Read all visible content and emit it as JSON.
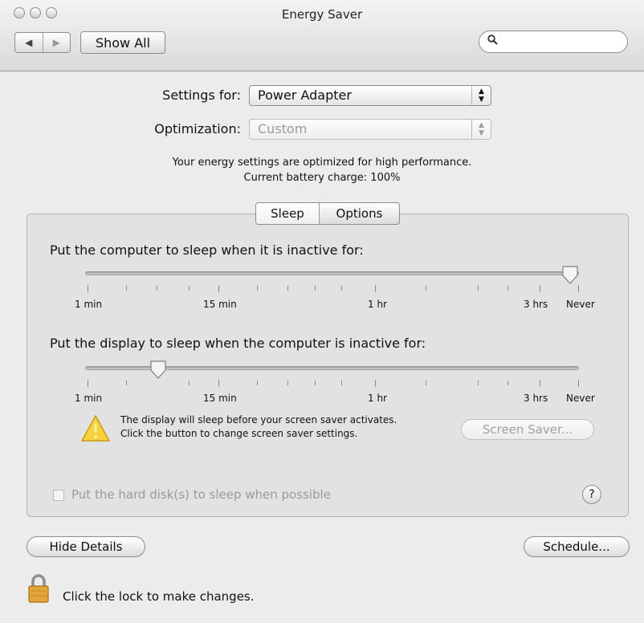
{
  "window": {
    "title": "Energy Saver"
  },
  "toolbar": {
    "back_glyph": "◀",
    "forward_glyph": "▶",
    "show_all_label": "Show All",
    "search_value": "",
    "search_icon": "magnifier-icon"
  },
  "settings": {
    "settings_for_label": "Settings for:",
    "settings_for_value": "Power Adapter",
    "optimization_label": "Optimization:",
    "optimization_value": "Custom",
    "info_line_1": "Your energy settings are optimized for high performance.",
    "info_line_2": "Current battery charge: 100%"
  },
  "tabs": [
    {
      "label": "Sleep",
      "selected": true
    },
    {
      "label": "Options",
      "selected": false
    }
  ],
  "sleep": {
    "computer_prompt": "Put the computer to sleep when it is inactive for:",
    "computer_value": "Never",
    "display_prompt": "Put the display to sleep when the computer is inactive for:",
    "display_value": "10 min",
    "tick_labels": {
      "min1": "1 min",
      "min15": "15 min",
      "hr1": "1 hr",
      "hrs3": "3 hrs",
      "never": "Never"
    },
    "warning_line_1": "The display will sleep before your screen saver activates.",
    "warning_line_2": "Click the button to change screen saver settings.",
    "screen_saver_label": "Screen Saver...",
    "hard_disk_label": "Put the hard disk(s) to sleep when possible",
    "hard_disk_checked": false,
    "help_glyph": "?"
  },
  "footer": {
    "hide_details_label": "Hide Details",
    "schedule_label": "Schedule...",
    "lock_text": "Click the lock to make changes."
  }
}
